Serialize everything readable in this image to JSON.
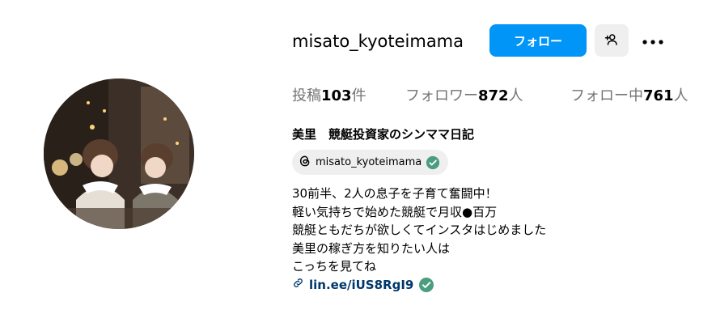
{
  "profile": {
    "username": "misato_kyoteimama",
    "follow_label": "フォロー",
    "stats": {
      "posts_label": "投稿",
      "posts_count": "103",
      "posts_unit": "件",
      "followers_label": "フォロワー",
      "followers_count": "872",
      "followers_unit": "人",
      "following_label": "フォロー中",
      "following_count": "761",
      "following_unit": "人"
    },
    "display_name": "美里　競艇投資家のシンママ日記",
    "threads_handle": "misato_kyoteimama",
    "bio_lines": [
      "30前半、2人の息子を子育て奮闘中！",
      "軽い気持ちで始めた競艇で月収●百万",
      "競艇ともだちが欲しくてインスタはじめました",
      "美里の稼ぎ方を知りたい人は",
      "こっちを見てね"
    ],
    "link_text": "lin.ee/iUS8RgI9"
  },
  "icons": {
    "suggest": "person-add-icon",
    "more": "more-dots-icon",
    "threads": "threads-icon",
    "verified": "verified-check-icon",
    "link": "link-icon"
  },
  "colors": {
    "accent": "#0095f6",
    "link": "#00376b",
    "verified": "#4a9d7f",
    "chip_bg": "#efefef"
  }
}
